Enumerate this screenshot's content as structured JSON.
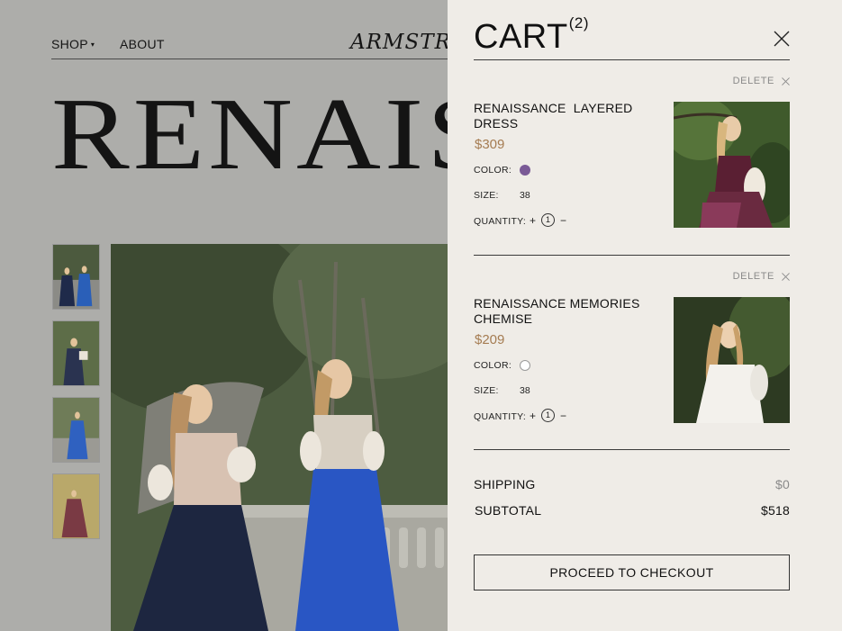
{
  "nav": {
    "shop_label": "SHOP",
    "shop_caret": "▾",
    "about_label": "ABOUT",
    "logo_text": "ARMSTREET"
  },
  "hero": {
    "title": "RENAISSANCE"
  },
  "cart": {
    "title": "CART",
    "count": "(2)",
    "delete_label": "DELETE",
    "color_label": "COLOR:",
    "size_label": "SIZE:",
    "quantity_label": "QUANTITY:",
    "qty_plus": "+",
    "qty_minus": "−",
    "items": [
      {
        "name": "RENAISSANCE  LAYERED\nDRESS",
        "price": "$309",
        "color_swatch": "#7a5a96",
        "size": "38",
        "quantity": "1"
      },
      {
        "name": "RENAISSANCE MEMORIES\nCHEMISE",
        "price": "$209",
        "color_swatch": "#ffffff",
        "size": "38",
        "quantity": "1"
      }
    ],
    "shipping_label": "SHIPPING",
    "shipping_value": "$0",
    "subtotal_label": "SUBTOTAL",
    "subtotal_value": "$518",
    "checkout_label": "PROCEED TO CHECKOUT"
  },
  "colors": {
    "page_bg": "#adadaa",
    "drawer_bg": "#efece7",
    "price": "#a57c52",
    "muted": "#8a8a8a"
  }
}
